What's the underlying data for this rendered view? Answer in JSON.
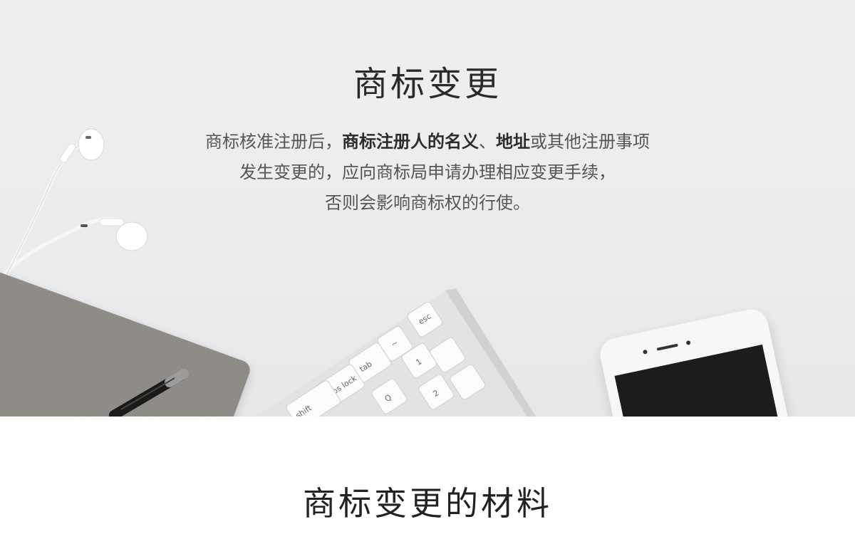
{
  "hero": {
    "title": "商标变更",
    "description": {
      "line1": {
        "part1": "商标核准注册后，",
        "bold1": "商标注册人的名义",
        "part2": "、",
        "bold2": "地址",
        "part3": "或其他注册事项"
      },
      "line2": "发生变更的，应向商标局申请办理相应变更手续，",
      "line3": "否则会影响商标权的行使。"
    },
    "keyboard_keys": {
      "esc": "esc",
      "tab": "tab",
      "caps_lock": "caps lock",
      "shift": "shift",
      "q": "Q",
      "two": "2",
      "one": "1",
      "tilde": "~"
    }
  },
  "section": {
    "title": "商标变更的材料"
  }
}
